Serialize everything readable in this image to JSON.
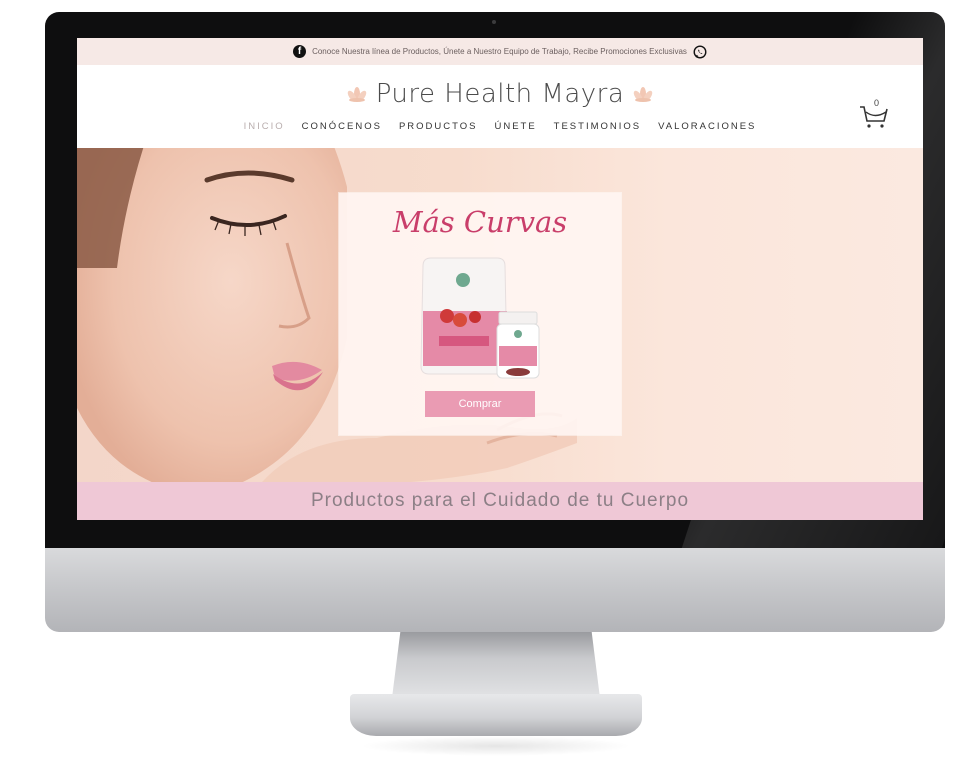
{
  "promo": {
    "text": "Conoce Nuestra línea de Productos, Únete a Nuestro Equipo de Trabajo, Recibe Promociones Exclusivas"
  },
  "brand": {
    "name": "Pure Health Mayra",
    "accent": "#c93e6a"
  },
  "nav": {
    "items": [
      {
        "label": "INICIO",
        "active": true
      },
      {
        "label": "CONÓCENOS",
        "active": false
      },
      {
        "label": "PRODUCTOS",
        "active": false
      },
      {
        "label": "ÚNETE",
        "active": false
      },
      {
        "label": "TESTIMONIOS",
        "active": false
      },
      {
        "label": "VALORACIONES",
        "active": false
      }
    ]
  },
  "cart": {
    "count": "0",
    "icon": "shopping-cart-icon"
  },
  "hero": {
    "card_title": "Más Curvas",
    "buy_label": "Comprar",
    "button_color": "#ea9bb3"
  },
  "banner": {
    "text": "Productos para el Cuidado de tu Cuerpo",
    "background": "#efc8d6"
  },
  "icons": {
    "social_left": "facebook-icon",
    "social_right": "whatsapp-icon",
    "brand_decor": "lotus-icon"
  }
}
